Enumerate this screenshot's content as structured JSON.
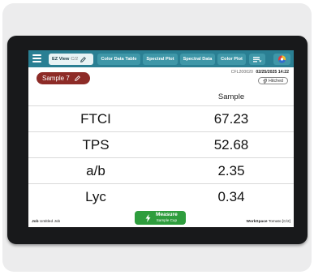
{
  "tabs": {
    "active": {
      "label": "EZ View",
      "sub": "C/2"
    },
    "items": [
      "Color Data Table",
      "Spectral Plot",
      "Spectral Data",
      "Color Plot"
    ]
  },
  "status": {
    "sample_label": "Sample 7",
    "instrument_id": "CFL200020",
    "datetime": "02/25/2025 14:22",
    "hitched_label": "Hitched"
  },
  "table": {
    "column_header": "Sample",
    "rows": [
      {
        "label": "FTCI",
        "value": "67.23"
      },
      {
        "label": "TPS",
        "value": "52.68"
      },
      {
        "label": "a/b",
        "value": "2.35"
      },
      {
        "label": "Lyc",
        "value": "0.34"
      }
    ]
  },
  "footer": {
    "job_key": "Job",
    "job_value": "Untitled Job",
    "workspace_key": "WorkSpace",
    "workspace_value": "Tomato [C/2]"
  },
  "measure": {
    "label": "Measure",
    "sub": "Sample Cup"
  },
  "icons": [
    "menu-icon",
    "pencil-icon",
    "list-filter-icon",
    "color-wheel-icon",
    "paperclip-icon",
    "lightning-icon"
  ],
  "colors": {
    "tabbar": "#2a7f93",
    "sample_pill": "#8d2b27",
    "measure_button": "#2e9d3d",
    "bezel": "#18191b"
  }
}
